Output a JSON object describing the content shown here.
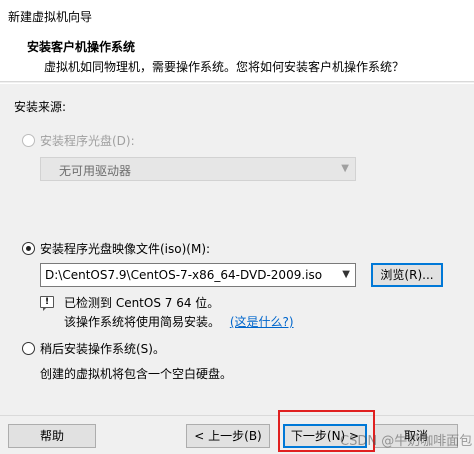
{
  "window": {
    "title": "新建虚拟机向导"
  },
  "header": {
    "title": "安装客户机操作系统",
    "subtitle": "虚拟机如同物理机，需要操作系统。您将如何安装客户机操作系统？"
  },
  "source_group": {
    "label": "安装来源:"
  },
  "option_disc": {
    "label": "安装程序光盘(D):",
    "selected": false,
    "enabled": false,
    "drive_value": "无可用驱动器"
  },
  "option_iso": {
    "label": "安装程序光盘映像文件(iso)(M):",
    "selected": true,
    "path_value": "D:\\CentOS7.9\\CentOS-7-x86_64-DVD-2009.iso",
    "browse_label": "浏览(R)...",
    "detected_text": "已检测到 CentOS 7 64 位。",
    "easy_install_text": "该操作系统将使用简易安装。",
    "what_is_link": "(这是什么?)"
  },
  "option_later": {
    "label": "稍后安装操作系统(S)。",
    "selected": false,
    "description": "创建的虚拟机将包含一个空白硬盘。"
  },
  "footer": {
    "help_label": "帮助",
    "back_label": "< 上一步(B)",
    "next_label": "下一步(N) >",
    "cancel_label": "取消"
  },
  "watermark": {
    "text": "CSDN @牛奶咖啡面包"
  },
  "colors": {
    "link": "#0066cc",
    "highlight": "#e02020",
    "focus": "#0078d7"
  },
  "icons": {
    "info": "info-icon",
    "dropdown": "chevron-down-icon"
  }
}
